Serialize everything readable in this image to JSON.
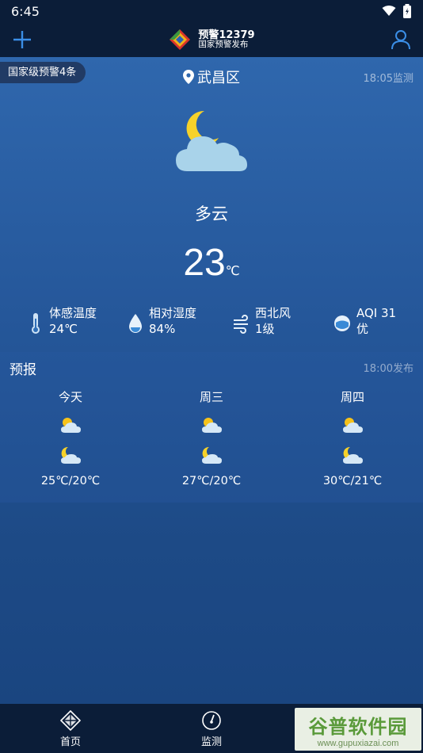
{
  "status": {
    "time": "6:45"
  },
  "header": {
    "brand_line1": "预警12379",
    "brand_line2": "国家预警发布"
  },
  "alert_chip": "国家级预警4条",
  "location": "武昌区",
  "monitor_time": "18:05监测",
  "current": {
    "condition": "多云",
    "temp": "23",
    "unit": "℃"
  },
  "details": [
    {
      "label": "体感温度",
      "value": "24℃",
      "icon": "thermometer-icon"
    },
    {
      "label": "相对湿度",
      "value": "84%",
      "icon": "humidity-drop-icon"
    },
    {
      "label": "西北风",
      "value": "1级",
      "icon": "wind-icon"
    },
    {
      "label": "AQI 31",
      "value": "优",
      "icon": "aqi-mask-icon"
    }
  ],
  "forecast": {
    "title": "预报",
    "pub_time": "18:00发布",
    "days": [
      {
        "day": "今天",
        "range": "25℃/20℃"
      },
      {
        "day": "周三",
        "range": "27℃/20℃"
      },
      {
        "day": "周四",
        "range": "30℃/21℃"
      }
    ]
  },
  "tabs": [
    {
      "label": "首页",
      "icon": "home-icon"
    },
    {
      "label": "监测",
      "icon": "gauge-icon"
    }
  ],
  "watermark": {
    "line1": "谷普软件园",
    "line2": "www.gupuxiazai.com"
  },
  "colors": {
    "bg_top": "#2f67ad",
    "bg_bottom": "#1a4580",
    "bar": "#0b1d38",
    "moon": "#f6d22a"
  }
}
